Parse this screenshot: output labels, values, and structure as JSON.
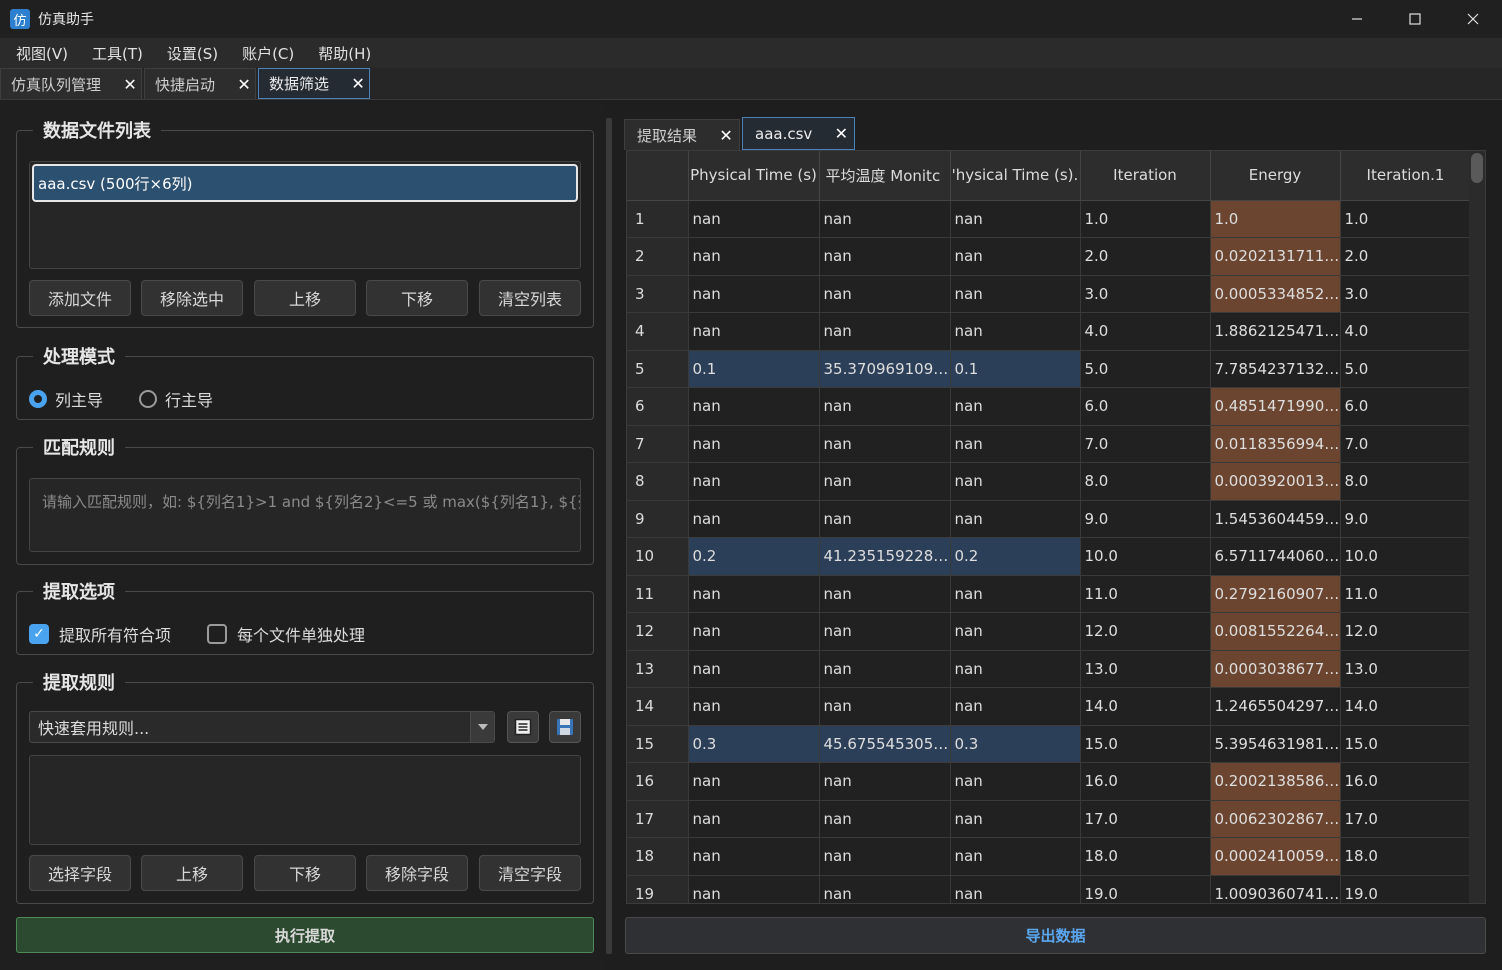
{
  "window": {
    "title": "仿真助手",
    "icon_glyph": "仿"
  },
  "menu": [
    "视图(V)",
    "工具(T)",
    "设置(S)",
    "账户(C)",
    "帮助(H)"
  ],
  "tabs": [
    {
      "label": "仿真队列管理",
      "active": false
    },
    {
      "label": "快捷启动",
      "active": false
    },
    {
      "label": "数据筛选",
      "active": true
    }
  ],
  "file_group": {
    "title": "数据文件列表",
    "files": [
      "aaa.csv (500行×6列)"
    ],
    "buttons": [
      "添加文件",
      "移除选中",
      "上移",
      "下移",
      "清空列表"
    ]
  },
  "mode_group": {
    "title": "处理模式",
    "options": [
      {
        "label": "列主导",
        "selected": true
      },
      {
        "label": "行主导",
        "selected": false
      }
    ]
  },
  "match_group": {
    "title": "匹配规则",
    "placeholder": "请输入匹配规则，如: ${列名1}>1 and ${列名2}<=5 或 max(${列名1}, ${列"
  },
  "extract_opts": {
    "title": "提取选项",
    "options": [
      {
        "label": "提取所有符合项",
        "checked": true
      },
      {
        "label": "每个文件单独处理",
        "checked": false
      }
    ]
  },
  "extract_rules": {
    "title": "提取规则",
    "combo_placeholder": "快速套用规则...",
    "buttons": [
      "选择字段",
      "上移",
      "下移",
      "移除字段",
      "清空字段"
    ]
  },
  "execute_label": "执行提取",
  "result_tabs": [
    {
      "label": "提取结果",
      "active": false
    },
    {
      "label": "aaa.csv",
      "active": true
    }
  ],
  "table": {
    "columns": [
      "Physical Time (s)",
      "平均温度 Monitc",
      "'hysical Time (s).",
      "Iteration",
      "Energy",
      "Iteration.1"
    ],
    "rows": [
      {
        "n": "1",
        "cells": [
          "nan",
          "nan",
          "nan",
          "1.0",
          "1.0",
          "1.0"
        ],
        "hl": "orange"
      },
      {
        "n": "2",
        "cells": [
          "nan",
          "nan",
          "nan",
          "2.0",
          "0.02021317113...",
          "2.0"
        ],
        "hl": "orange"
      },
      {
        "n": "3",
        "cells": [
          "nan",
          "nan",
          "nan",
          "3.0",
          "0.00053348529...",
          "3.0"
        ],
        "hl": "orange"
      },
      {
        "n": "4",
        "cells": [
          "nan",
          "nan",
          "nan",
          "4.0",
          "1.88621254710...",
          "4.0"
        ],
        "hl": ""
      },
      {
        "n": "5",
        "cells": [
          "0.1",
          "35.3709691091...",
          "0.1",
          "5.0",
          "7.78542371329...",
          "5.0"
        ],
        "hl": "blue"
      },
      {
        "n": "6",
        "cells": [
          "nan",
          "nan",
          "nan",
          "6.0",
          "0.48514719902...",
          "6.0"
        ],
        "hl": "orange"
      },
      {
        "n": "7",
        "cells": [
          "nan",
          "nan",
          "nan",
          "7.0",
          "0.01183569941...",
          "7.0"
        ],
        "hl": "orange"
      },
      {
        "n": "8",
        "cells": [
          "nan",
          "nan",
          "nan",
          "8.0",
          "0.00039200137...",
          "8.0"
        ],
        "hl": "orange"
      },
      {
        "n": "9",
        "cells": [
          "nan",
          "nan",
          "nan",
          "9.0",
          "1.54536044591...",
          "9.0"
        ],
        "hl": ""
      },
      {
        "n": "10",
        "cells": [
          "0.2",
          "41.2351592286...",
          "0.2",
          "10.0",
          "6.57117440606...",
          "10.0"
        ],
        "hl": "blue"
      },
      {
        "n": "11",
        "cells": [
          "nan",
          "nan",
          "nan",
          "11.0",
          "0.27921609072...",
          "11.0"
        ],
        "hl": "orange"
      },
      {
        "n": "12",
        "cells": [
          "nan",
          "nan",
          "nan",
          "12.0",
          "0.00815522648...",
          "12.0"
        ],
        "hl": "orange"
      },
      {
        "n": "13",
        "cells": [
          "nan",
          "nan",
          "nan",
          "13.0",
          "0.00030386777...",
          "13.0"
        ],
        "hl": "orange"
      },
      {
        "n": "14",
        "cells": [
          "nan",
          "nan",
          "nan",
          "14.0",
          "1.24655042975...",
          "14.0"
        ],
        "hl": ""
      },
      {
        "n": "15",
        "cells": [
          "0.3",
          "45.6755453053...",
          "0.3",
          "15.0",
          "5.39546319817...",
          "15.0"
        ],
        "hl": "blue"
      },
      {
        "n": "16",
        "cells": [
          "nan",
          "nan",
          "nan",
          "16.0",
          "0.20021385862...",
          "16.0"
        ],
        "hl": "orange"
      },
      {
        "n": "17",
        "cells": [
          "nan",
          "nan",
          "nan",
          "17.0",
          "0.00623028675...",
          "17.0"
        ],
        "hl": "orange"
      },
      {
        "n": "18",
        "cells": [
          "nan",
          "nan",
          "nan",
          "18.0",
          "0.00024100593...",
          "18.0"
        ],
        "hl": "orange"
      },
      {
        "n": "19",
        "cells": [
          "nan",
          "nan",
          "nan",
          "19.0",
          "1.00903607418...",
          "19.0"
        ],
        "hl": ""
      }
    ]
  },
  "export_label": "导出数据",
  "colors": {
    "accent": "#4aa3ef",
    "row_blue": "#2b3f58",
    "cell_orange": "#6b4530",
    "exec_green": "#2b4a2f"
  }
}
